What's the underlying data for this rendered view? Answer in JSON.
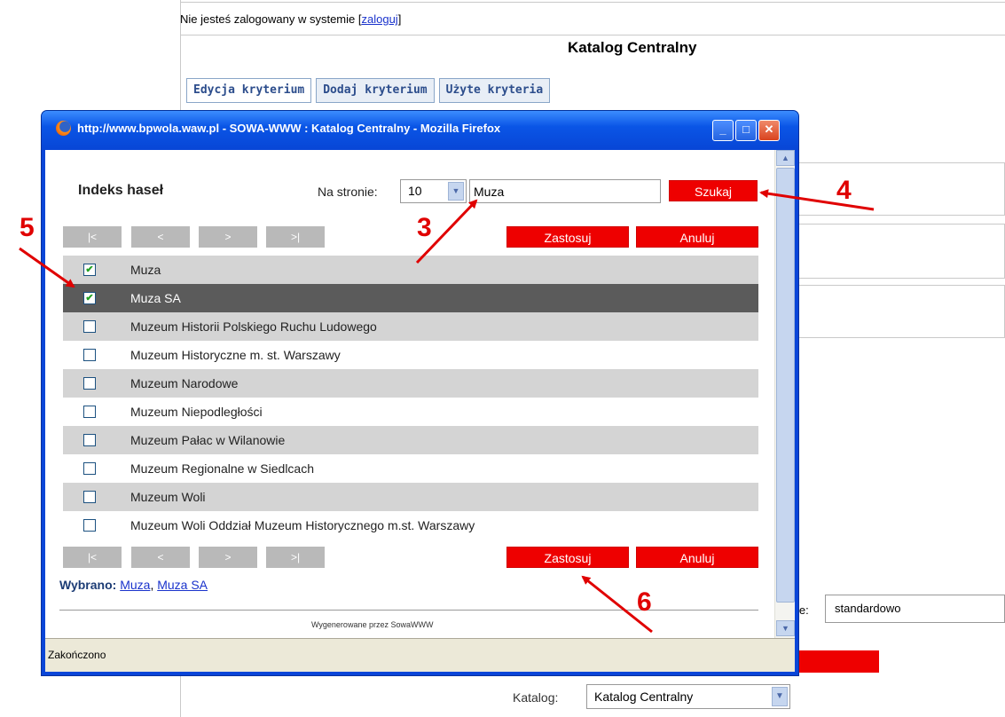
{
  "page": {
    "login_prefix": "Nie jesteś zalogowany w systemie [",
    "login_link": "zaloguj",
    "login_suffix": "]",
    "title": "Katalog Centralny",
    "tabs": [
      {
        "label": "Edycja kryterium",
        "active": true
      },
      {
        "label": "Dodaj kryterium",
        "active": false
      },
      {
        "label": "Użyte kryteria",
        "active": false
      }
    ],
    "field_label": "ie:",
    "field_value": "standardowo",
    "katalog_label": "Katalog:",
    "katalog_value": "Katalog Centralny"
  },
  "popup": {
    "window_title": "http://www.bpwola.waw.pl - SOWA-WWW : Katalog Centralny - Mozilla Firefox",
    "heading": "Indeks haseł",
    "per_page_label": "Na stronie:",
    "per_page_value": "10",
    "search_value": "Muza",
    "search_button": "Szukaj",
    "nav": {
      "first": "|<",
      "prev": "<",
      "next": ">",
      "last": ">|"
    },
    "apply_button": "Zastosuj",
    "cancel_button": "Anuluj",
    "items": [
      {
        "label": "Muza",
        "checked": true
      },
      {
        "label": "Muza SA",
        "checked": true
      },
      {
        "label": "Muzeum Historii Polskiego Ruchu Ludowego",
        "checked": false
      },
      {
        "label": "Muzeum Historyczne m. st. Warszawy",
        "checked": false
      },
      {
        "label": "Muzeum Narodowe",
        "checked": false
      },
      {
        "label": "Muzeum Niepodległości",
        "checked": false
      },
      {
        "label": "Muzeum Pałac w Wilanowie",
        "checked": false
      },
      {
        "label": "Muzeum Regionalne w Siedlcach",
        "checked": false
      },
      {
        "label": "Muzeum Woli",
        "checked": false
      },
      {
        "label": "Muzeum Woli Oddział Muzeum Historycznego m.st. Warszawy",
        "checked": false
      }
    ],
    "selected_label": "Wybrano:",
    "selected_items": [
      "Muza",
      "Muza SA"
    ],
    "generated_by": "Wygenerowane przez SowaWWW",
    "status": "Zakończono"
  },
  "annotations": {
    "n3": "3",
    "n4": "4",
    "n5": "5",
    "n6": "6"
  },
  "colors": {
    "accent_red": "#ee0000",
    "xp_blue": "#0a46d8",
    "row_shade": "#d4d4d4",
    "row_selected": "#5b5b5b"
  }
}
